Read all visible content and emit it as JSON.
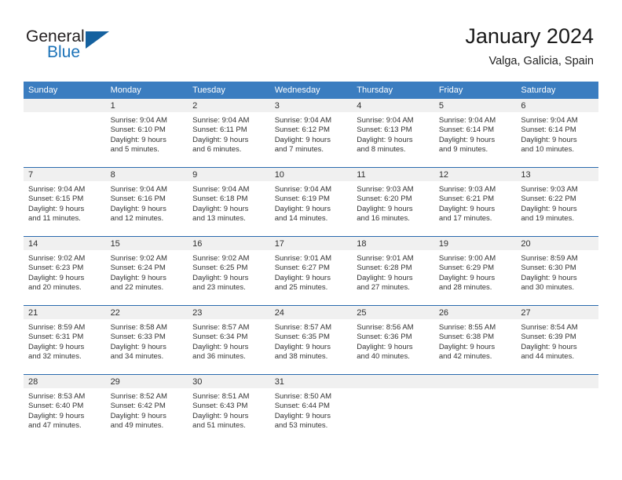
{
  "brand": {
    "name_top": "General",
    "name_bottom": "Blue",
    "logo_icon": "triangle-logo-icon",
    "accent_color": "#1b72b8"
  },
  "header": {
    "title": "January 2024",
    "subtitle": "Valga, Galicia, Spain"
  },
  "theme": {
    "header_row_color": "#3b7dc0",
    "day_band_color": "#f0f0f0",
    "row_divider_color": "#2a6aae"
  },
  "weekdays": [
    "Sunday",
    "Monday",
    "Tuesday",
    "Wednesday",
    "Thursday",
    "Friday",
    "Saturday"
  ],
  "weeks": [
    [
      {
        "day": "",
        "sunrise": "",
        "sunset": "",
        "daylight1": "",
        "daylight2": ""
      },
      {
        "day": "1",
        "sunrise": "Sunrise: 9:04 AM",
        "sunset": "Sunset: 6:10 PM",
        "daylight1": "Daylight: 9 hours",
        "daylight2": "and 5 minutes."
      },
      {
        "day": "2",
        "sunrise": "Sunrise: 9:04 AM",
        "sunset": "Sunset: 6:11 PM",
        "daylight1": "Daylight: 9 hours",
        "daylight2": "and 6 minutes."
      },
      {
        "day": "3",
        "sunrise": "Sunrise: 9:04 AM",
        "sunset": "Sunset: 6:12 PM",
        "daylight1": "Daylight: 9 hours",
        "daylight2": "and 7 minutes."
      },
      {
        "day": "4",
        "sunrise": "Sunrise: 9:04 AM",
        "sunset": "Sunset: 6:13 PM",
        "daylight1": "Daylight: 9 hours",
        "daylight2": "and 8 minutes."
      },
      {
        "day": "5",
        "sunrise": "Sunrise: 9:04 AM",
        "sunset": "Sunset: 6:14 PM",
        "daylight1": "Daylight: 9 hours",
        "daylight2": "and 9 minutes."
      },
      {
        "day": "6",
        "sunrise": "Sunrise: 9:04 AM",
        "sunset": "Sunset: 6:14 PM",
        "daylight1": "Daylight: 9 hours",
        "daylight2": "and 10 minutes."
      }
    ],
    [
      {
        "day": "7",
        "sunrise": "Sunrise: 9:04 AM",
        "sunset": "Sunset: 6:15 PM",
        "daylight1": "Daylight: 9 hours",
        "daylight2": "and 11 minutes."
      },
      {
        "day": "8",
        "sunrise": "Sunrise: 9:04 AM",
        "sunset": "Sunset: 6:16 PM",
        "daylight1": "Daylight: 9 hours",
        "daylight2": "and 12 minutes."
      },
      {
        "day": "9",
        "sunrise": "Sunrise: 9:04 AM",
        "sunset": "Sunset: 6:18 PM",
        "daylight1": "Daylight: 9 hours",
        "daylight2": "and 13 minutes."
      },
      {
        "day": "10",
        "sunrise": "Sunrise: 9:04 AM",
        "sunset": "Sunset: 6:19 PM",
        "daylight1": "Daylight: 9 hours",
        "daylight2": "and 14 minutes."
      },
      {
        "day": "11",
        "sunrise": "Sunrise: 9:03 AM",
        "sunset": "Sunset: 6:20 PM",
        "daylight1": "Daylight: 9 hours",
        "daylight2": "and 16 minutes."
      },
      {
        "day": "12",
        "sunrise": "Sunrise: 9:03 AM",
        "sunset": "Sunset: 6:21 PM",
        "daylight1": "Daylight: 9 hours",
        "daylight2": "and 17 minutes."
      },
      {
        "day": "13",
        "sunrise": "Sunrise: 9:03 AM",
        "sunset": "Sunset: 6:22 PM",
        "daylight1": "Daylight: 9 hours",
        "daylight2": "and 19 minutes."
      }
    ],
    [
      {
        "day": "14",
        "sunrise": "Sunrise: 9:02 AM",
        "sunset": "Sunset: 6:23 PM",
        "daylight1": "Daylight: 9 hours",
        "daylight2": "and 20 minutes."
      },
      {
        "day": "15",
        "sunrise": "Sunrise: 9:02 AM",
        "sunset": "Sunset: 6:24 PM",
        "daylight1": "Daylight: 9 hours",
        "daylight2": "and 22 minutes."
      },
      {
        "day": "16",
        "sunrise": "Sunrise: 9:02 AM",
        "sunset": "Sunset: 6:25 PM",
        "daylight1": "Daylight: 9 hours",
        "daylight2": "and 23 minutes."
      },
      {
        "day": "17",
        "sunrise": "Sunrise: 9:01 AM",
        "sunset": "Sunset: 6:27 PM",
        "daylight1": "Daylight: 9 hours",
        "daylight2": "and 25 minutes."
      },
      {
        "day": "18",
        "sunrise": "Sunrise: 9:01 AM",
        "sunset": "Sunset: 6:28 PM",
        "daylight1": "Daylight: 9 hours",
        "daylight2": "and 27 minutes."
      },
      {
        "day": "19",
        "sunrise": "Sunrise: 9:00 AM",
        "sunset": "Sunset: 6:29 PM",
        "daylight1": "Daylight: 9 hours",
        "daylight2": "and 28 minutes."
      },
      {
        "day": "20",
        "sunrise": "Sunrise: 8:59 AM",
        "sunset": "Sunset: 6:30 PM",
        "daylight1": "Daylight: 9 hours",
        "daylight2": "and 30 minutes."
      }
    ],
    [
      {
        "day": "21",
        "sunrise": "Sunrise: 8:59 AM",
        "sunset": "Sunset: 6:31 PM",
        "daylight1": "Daylight: 9 hours",
        "daylight2": "and 32 minutes."
      },
      {
        "day": "22",
        "sunrise": "Sunrise: 8:58 AM",
        "sunset": "Sunset: 6:33 PM",
        "daylight1": "Daylight: 9 hours",
        "daylight2": "and 34 minutes."
      },
      {
        "day": "23",
        "sunrise": "Sunrise: 8:57 AM",
        "sunset": "Sunset: 6:34 PM",
        "daylight1": "Daylight: 9 hours",
        "daylight2": "and 36 minutes."
      },
      {
        "day": "24",
        "sunrise": "Sunrise: 8:57 AM",
        "sunset": "Sunset: 6:35 PM",
        "daylight1": "Daylight: 9 hours",
        "daylight2": "and 38 minutes."
      },
      {
        "day": "25",
        "sunrise": "Sunrise: 8:56 AM",
        "sunset": "Sunset: 6:36 PM",
        "daylight1": "Daylight: 9 hours",
        "daylight2": "and 40 minutes."
      },
      {
        "day": "26",
        "sunrise": "Sunrise: 8:55 AM",
        "sunset": "Sunset: 6:38 PM",
        "daylight1": "Daylight: 9 hours",
        "daylight2": "and 42 minutes."
      },
      {
        "day": "27",
        "sunrise": "Sunrise: 8:54 AM",
        "sunset": "Sunset: 6:39 PM",
        "daylight1": "Daylight: 9 hours",
        "daylight2": "and 44 minutes."
      }
    ],
    [
      {
        "day": "28",
        "sunrise": "Sunrise: 8:53 AM",
        "sunset": "Sunset: 6:40 PM",
        "daylight1": "Daylight: 9 hours",
        "daylight2": "and 47 minutes."
      },
      {
        "day": "29",
        "sunrise": "Sunrise: 8:52 AM",
        "sunset": "Sunset: 6:42 PM",
        "daylight1": "Daylight: 9 hours",
        "daylight2": "and 49 minutes."
      },
      {
        "day": "30",
        "sunrise": "Sunrise: 8:51 AM",
        "sunset": "Sunset: 6:43 PM",
        "daylight1": "Daylight: 9 hours",
        "daylight2": "and 51 minutes."
      },
      {
        "day": "31",
        "sunrise": "Sunrise: 8:50 AM",
        "sunset": "Sunset: 6:44 PM",
        "daylight1": "Daylight: 9 hours",
        "daylight2": "and 53 minutes."
      },
      {
        "day": "",
        "sunrise": "",
        "sunset": "",
        "daylight1": "",
        "daylight2": ""
      },
      {
        "day": "",
        "sunrise": "",
        "sunset": "",
        "daylight1": "",
        "daylight2": ""
      },
      {
        "day": "",
        "sunrise": "",
        "sunset": "",
        "daylight1": "",
        "daylight2": ""
      }
    ]
  ]
}
